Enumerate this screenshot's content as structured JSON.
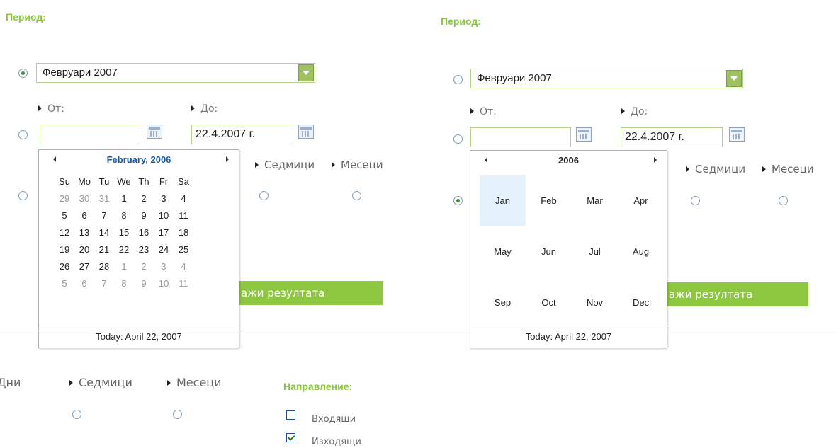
{
  "left": {
    "period_title": "Период:",
    "period_select_value": "Февруари 2007",
    "from_label": "От:",
    "to_label": "До:",
    "from_value": "",
    "to_value": "22.4.2007 г.",
    "weeks_label": "Седмици",
    "months_label": "Месеци",
    "button_text": "ажи резултата",
    "calendar": {
      "title": "February, 2006",
      "weekdays": [
        "Su",
        "Mo",
        "Tu",
        "We",
        "Th",
        "Fr",
        "Sa"
      ],
      "weeks": [
        [
          "29",
          "30",
          "31",
          "1",
          "2",
          "3",
          "4"
        ],
        [
          "5",
          "6",
          "7",
          "8",
          "9",
          "10",
          "11"
        ],
        [
          "12",
          "13",
          "14",
          "15",
          "16",
          "17",
          "18"
        ],
        [
          "19",
          "20",
          "21",
          "22",
          "23",
          "24",
          "25"
        ],
        [
          "26",
          "27",
          "28",
          "1",
          "2",
          "3",
          "4"
        ],
        [
          "5",
          "6",
          "7",
          "8",
          "9",
          "10",
          "11"
        ]
      ],
      "today": "Today: April 22, 2007"
    }
  },
  "right": {
    "period_title": "Период:",
    "period_select_value": "Февруари 2007",
    "from_label": "От:",
    "to_label": "До:",
    "from_value": "",
    "to_value": "22.4.2007 г.",
    "weeks_label": "Седмици",
    "months_label": "Месеци",
    "button_text": "ажи резултата",
    "calendar": {
      "title": "2006",
      "months": [
        [
          "Jan",
          "Feb",
          "Mar",
          "Apr"
        ],
        [
          "May",
          "Jun",
          "Jul",
          "Aug"
        ],
        [
          "Sep",
          "Oct",
          "Nov",
          "Dec"
        ]
      ],
      "selected_month": "Jan",
      "today": "Today: April 22, 2007"
    }
  },
  "bottom": {
    "days_label": "Дни",
    "weeks_label": "Седмици",
    "months_label": "Месеци",
    "direction_title": "Направление:",
    "incoming_label": "Входящи",
    "outgoing_label": "Изходящи"
  }
}
